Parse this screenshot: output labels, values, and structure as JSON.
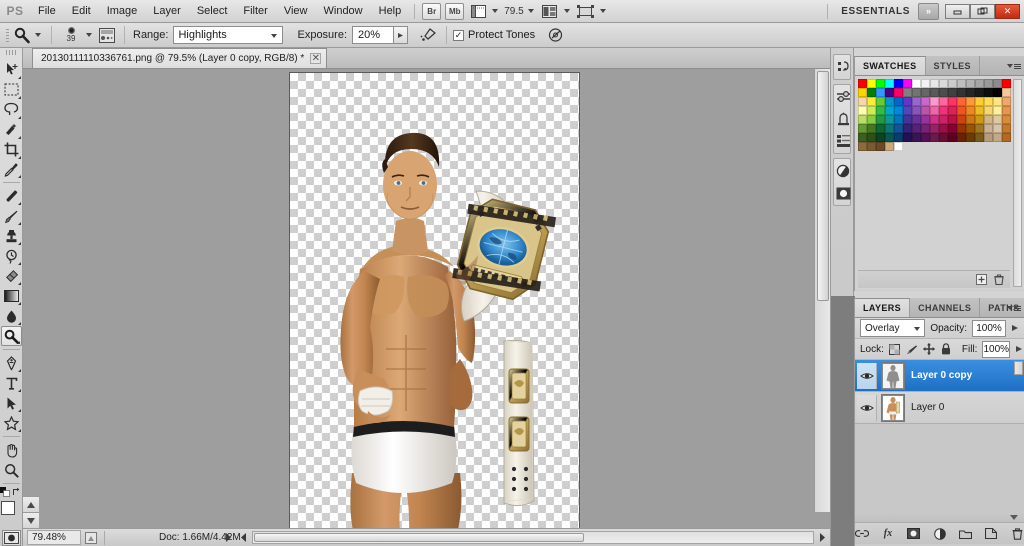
{
  "app": {
    "logo": "PS",
    "workspace": "ESSENTIALS",
    "expand_icon": "»",
    "minimize_label": "–",
    "restore_label": "❐",
    "close_label": "✕"
  },
  "menu": {
    "items": [
      "File",
      "Edit",
      "Image",
      "Layer",
      "Select",
      "Filter",
      "View",
      "Window",
      "Help"
    ],
    "bridge_label": "Br",
    "mini_bridge_label": "Mb",
    "zoom_value": "79.5"
  },
  "options": {
    "range_label": "Range:",
    "range_value": "Highlights",
    "exposure_label": "Exposure:",
    "exposure_value": "20%",
    "protect_tones_label": "Protect Tones",
    "protect_tones_checked": true,
    "brush_size": "39"
  },
  "document": {
    "tab_title": "20130111110336761.png @ 79.5% (Layer 0 copy, RGB/8) *",
    "close_label": "✕"
  },
  "status": {
    "zoom": "79.48%",
    "doc_info": "Doc: 1.66M/4.42M"
  },
  "tools": [
    {
      "name": "move-tool",
      "has_flyout": true
    },
    {
      "name": "marquee-tool",
      "has_flyout": true
    },
    {
      "name": "lasso-tool",
      "has_flyout": true
    },
    {
      "name": "quick-selection-tool",
      "has_flyout": true
    },
    {
      "name": "crop-tool",
      "has_flyout": true
    },
    {
      "name": "eyedropper-tool",
      "has_flyout": true
    },
    {
      "name": "spot-healing-brush-tool",
      "has_flyout": true
    },
    {
      "name": "brush-tool",
      "has_flyout": true
    },
    {
      "name": "clone-stamp-tool",
      "has_flyout": true
    },
    {
      "name": "history-brush-tool",
      "has_flyout": true
    },
    {
      "name": "eraser-tool",
      "has_flyout": true
    },
    {
      "name": "gradient-tool",
      "has_flyout": true
    },
    {
      "name": "blur-tool",
      "has_flyout": true
    },
    {
      "name": "dodge-tool",
      "has_flyout": true,
      "active": true
    },
    {
      "name": "pen-tool",
      "has_flyout": true
    },
    {
      "name": "type-tool",
      "has_flyout": true
    },
    {
      "name": "path-selection-tool",
      "has_flyout": true
    },
    {
      "name": "shape-tool",
      "has_flyout": true
    },
    {
      "name": "hand-tool",
      "has_flyout": false
    },
    {
      "name": "zoom-tool",
      "has_flyout": false
    }
  ],
  "colors": {
    "foreground": "#ffffff",
    "background": "#f08a28",
    "layer_selected": "#1f6fc4",
    "canvas_bg": "#9e9e9e",
    "close_button": "#c22a12"
  },
  "swatches": {
    "tabs": [
      {
        "label": "SWATCHES",
        "active": true
      },
      {
        "label": "STYLES",
        "active": false
      }
    ],
    "grid": [
      [
        "#ff0000",
        "#ffff00",
        "#00ff00",
        "#00ffff",
        "#0000ff",
        "#ff00ff",
        "#ffffff",
        "#f2f2f2",
        "#e6e6e6",
        "#d9d9d9",
        "#cccccc",
        "#bfbfbf",
        "#b3b3b3",
        "#a6a6a6",
        "#999999",
        "#8c8c8c",
        "#ff0000"
      ],
      [
        "#ffd400",
        "#008000",
        "#3399ff",
        "#4b0082",
        "#ff0066",
        "#808080",
        "#737373",
        "#666666",
        "#595959",
        "#4d4d4d",
        "#404040",
        "#333333",
        "#262626",
        "#1a1a1a",
        "#0d0d0d",
        "#000000",
        "#f5c79a"
      ],
      [
        "#f5d7a8",
        "#ffeb3b",
        "#66cc33",
        "#0099cc",
        "#0066cc",
        "#6633cc",
        "#9966cc",
        "#cc66cc",
        "#ff99cc",
        "#ff6699",
        "#ff3366",
        "#ff6633",
        "#ff9933",
        "#ffcc33",
        "#ffdd55",
        "#ffe680",
        "#f0a868"
      ],
      [
        "#ffffaa",
        "#ccee55",
        "#33bb44",
        "#00aacc",
        "#0088dd",
        "#5544bb",
        "#8855bb",
        "#bb55aa",
        "#ee66aa",
        "#ee3377",
        "#dd2255",
        "#ee5522",
        "#ee8822",
        "#eebb22",
        "#f5d76e",
        "#fff0a0",
        "#e8954f"
      ],
      [
        "#bbdd66",
        "#88cc44",
        "#229944",
        "#119999",
        "#0077bb",
        "#443399",
        "#663399",
        "#993399",
        "#cc3388",
        "#cc2266",
        "#bb1144",
        "#cc4411",
        "#cc7711",
        "#cc9911",
        "#d4b483",
        "#e0c9a0",
        "#d98b3c"
      ],
      [
        "#669933",
        "#447722",
        "#116633",
        "#0d7777",
        "#115599",
        "#332277",
        "#552277",
        "#772277",
        "#992266",
        "#991144",
        "#880033",
        "#993300",
        "#995500",
        "#a07722",
        "#cbb094",
        "#d8c4aa",
        "#c47a2c"
      ],
      [
        "#3a5f1f",
        "#2d5016",
        "#0a4422",
        "#0a5555",
        "#0a3d6b",
        "#221155",
        "#3a1555",
        "#551155",
        "#6b1a4d",
        "#6b0d33",
        "#5c0022",
        "#6b2200",
        "#6b3c00",
        "#7a5a1a",
        "#b79b7d",
        "#c4a989",
        "#b06a22"
      ],
      [
        "#8b6b3f",
        "#7a5a33",
        "#6b4a28",
        "#c9a97a",
        "#ffffff"
      ]
    ]
  },
  "layers": {
    "tabs": [
      {
        "label": "LAYERS",
        "active": true
      },
      {
        "label": "CHANNELS",
        "active": false
      },
      {
        "label": "PATHS",
        "active": false
      }
    ],
    "blend_mode": "Overlay",
    "opacity_label": "Opacity:",
    "opacity_value": "100%",
    "lock_label": "Lock:",
    "fill_label": "Fill:",
    "fill_value": "100%",
    "lock_icons": [
      "lock-transparent-pixels-icon",
      "lock-image-pixels-icon",
      "lock-position-icon",
      "lock-all-icon"
    ],
    "items": [
      {
        "name": "Layer 0 copy",
        "selected": true,
        "visible": true
      },
      {
        "name": "Layer 0",
        "selected": false,
        "visible": true
      }
    ],
    "footer_icons": [
      "link-layers-icon",
      "add-layer-style-icon",
      "add-layer-mask-icon",
      "new-adjustment-layer-icon",
      "new-group-icon",
      "new-layer-icon",
      "delete-layer-icon"
    ],
    "footer_fx_label": "fx"
  },
  "dock": {
    "buttons": [
      "history-icon",
      "adjustments-icon",
      "styles-icon",
      "layer-comps-icon",
      "color-icon",
      "mask-icon"
    ]
  }
}
